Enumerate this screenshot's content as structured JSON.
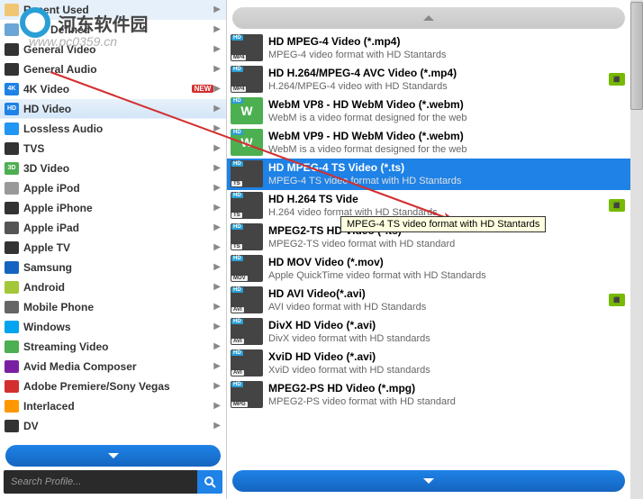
{
  "watermark": {
    "text": "河东软件园",
    "url": "www.pc0359.cn"
  },
  "search": {
    "placeholder": "Search Profile..."
  },
  "categories": [
    {
      "id": "recent",
      "label": "Recent Used",
      "icon": "ic-recent"
    },
    {
      "id": "user",
      "label": "User Defined",
      "icon": "ic-user"
    },
    {
      "id": "genv",
      "label": "General Video",
      "icon": "ic-genv"
    },
    {
      "id": "gena",
      "label": "General Audio",
      "icon": "ic-gena"
    },
    {
      "id": "4k",
      "label": "4K Video",
      "icon": "ic-4k",
      "icon_text": "4K",
      "badge": "NEW"
    },
    {
      "id": "hd",
      "label": "HD Video",
      "icon": "ic-hd",
      "icon_text": "HD",
      "active": true
    },
    {
      "id": "lossless",
      "label": "Lossless Audio",
      "icon": "ic-loss"
    },
    {
      "id": "tvs",
      "label": "TVS",
      "icon": "ic-tvs"
    },
    {
      "id": "3d",
      "label": "3D Video",
      "icon": "ic-3d",
      "icon_text": "3D"
    },
    {
      "id": "ipod",
      "label": "Apple iPod",
      "icon": "ic-ipod"
    },
    {
      "id": "iphone",
      "label": "Apple iPhone",
      "icon": "ic-iphone"
    },
    {
      "id": "ipad",
      "label": "Apple iPad",
      "icon": "ic-ipad"
    },
    {
      "id": "appletv",
      "label": "Apple TV",
      "icon": "ic-atv"
    },
    {
      "id": "samsung",
      "label": "Samsung",
      "icon": "ic-samsung"
    },
    {
      "id": "android",
      "label": "Android",
      "icon": "ic-android"
    },
    {
      "id": "mobile",
      "label": "Mobile Phone",
      "icon": "ic-mobile"
    },
    {
      "id": "windows",
      "label": "Windows",
      "icon": "ic-win"
    },
    {
      "id": "stream",
      "label": "Streaming Video",
      "icon": "ic-stream"
    },
    {
      "id": "avid",
      "label": "Avid Media Composer",
      "icon": "ic-avid"
    },
    {
      "id": "adobe",
      "label": "Adobe Premiere/Sony Vegas",
      "icon": "ic-adobe"
    },
    {
      "id": "interlaced",
      "label": "Interlaced",
      "icon": "ic-inter"
    },
    {
      "id": "dv",
      "label": "DV",
      "icon": "ic-dv"
    }
  ],
  "formats": [
    {
      "code": "MP4",
      "title": "HD MPEG-4 Video (*.mp4)",
      "desc": "MPEG-4 video format with HD Stantards"
    },
    {
      "code": "MP4",
      "title": "HD H.264/MPEG-4 AVC Video (*.mp4)",
      "desc": "H.264/MPEG-4 video with HD Standards",
      "nvidia": true
    },
    {
      "code": "",
      "title": "WebM VP8 - HD WebM Video (*.webm)",
      "desc": "WebM is a video format designed for the web",
      "webm": true
    },
    {
      "code": "",
      "title": "WebM VP9 - HD WebM Video (*.webm)",
      "desc": "WebM is a video format designed for the web",
      "webm": true
    },
    {
      "code": "TS",
      "title": "HD MPEG-4 TS Video (*.ts)",
      "desc": "MPEG-4 TS video format with HD Stantards",
      "selected": true
    },
    {
      "code": "TS",
      "title": "HD H.264 TS Vide",
      "desc": "H.264 video format with HD Standards",
      "nvidia": true
    },
    {
      "code": "TS",
      "title": "MPEG2-TS HD Video (*.ts)",
      "desc": "MPEG2-TS video format with HD standard"
    },
    {
      "code": "MOV",
      "title": "HD MOV Video (*.mov)",
      "desc": "Apple QuickTime video format with HD Standards"
    },
    {
      "code": "AVI",
      "title": "HD AVI Video(*.avi)",
      "desc": "AVI video format with HD Standards",
      "nvidia": true
    },
    {
      "code": "AVI",
      "title": "DivX HD Video (*.avi)",
      "desc": "DivX video format with HD standards"
    },
    {
      "code": "AVI",
      "title": "XviD HD Video (*.avi)",
      "desc": "XviD video format with HD standards"
    },
    {
      "code": "MPG",
      "title": "MPEG2-PS HD Video (*.mpg)",
      "desc": "MPEG2-PS video format with HD standard"
    }
  ],
  "tooltip": {
    "text": "MPEG-4 TS video format with HD Stantards"
  }
}
